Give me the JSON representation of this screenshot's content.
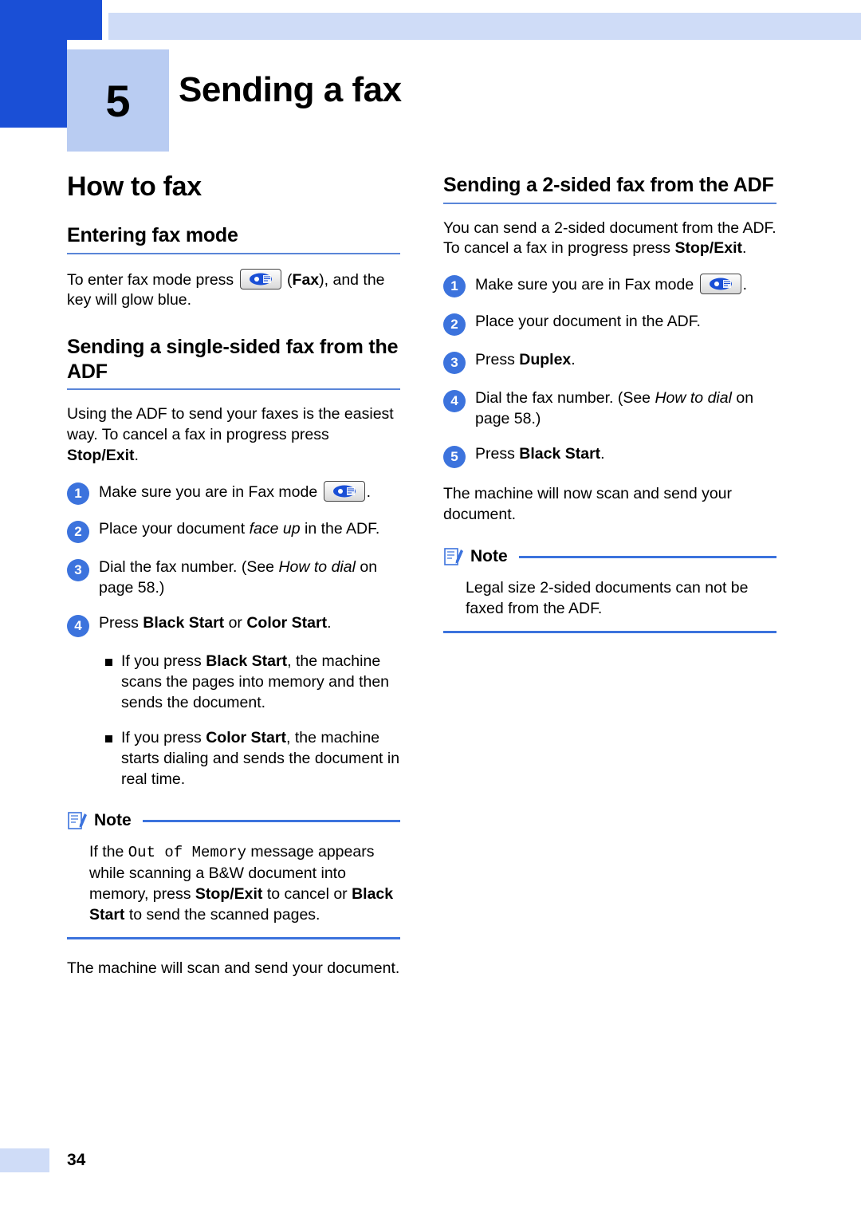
{
  "chapter": {
    "number": "5",
    "title": "Sending a fax"
  },
  "left": {
    "section_title": "How to fax",
    "entering": {
      "heading": "Entering fax mode",
      "para_a": "To enter fax mode press",
      "para_b": "(",
      "fax_bold": "Fax",
      "para_c": "), and the key will glow blue."
    },
    "single": {
      "heading": "Sending a single-sided fax from the ADF",
      "intro_a": "Using the ADF to send your faxes is the easiest way. To cancel a fax in progress press ",
      "intro_bold": "Stop/Exit",
      "intro_b": ".",
      "steps": [
        {
          "num": "1",
          "text": "Make sure you are in Fax mode",
          "suffix": "."
        },
        {
          "num": "2",
          "text_a": "Place your document ",
          "italic": "face up",
          "text_b": " in the ADF."
        },
        {
          "num": "3",
          "text_a": "Dial the fax number. (See ",
          "italic_a": "How to",
          "italic_b": "dial",
          "text_b": " on page 58.)"
        },
        {
          "num": "4",
          "text_a": "Press ",
          "bold_a": "Black Start",
          "text_b": " or ",
          "bold_b": "Color Start",
          "text_c": "."
        }
      ],
      "bullets": [
        {
          "text_a": "If you press ",
          "bold": "Black Start",
          "text_b": ", the machine scans the pages into memory and then sends the document."
        },
        {
          "text_a": "If you press ",
          "bold": "Color Start",
          "text_b": ", the machine starts dialing and sends the document in real time."
        }
      ]
    },
    "note": {
      "label": "Note",
      "body_a": "If the ",
      "mono": "Out of Memory",
      "body_b": " message appears while scanning a B&W document into memory, press ",
      "bold_a": "Stop/Exit",
      "body_c": " to cancel or ",
      "bold_b": "Black Start",
      "body_d": " to send the scanned pages."
    },
    "closing": "The machine will scan and send your document."
  },
  "right": {
    "twosided": {
      "heading": "Sending a 2-sided fax from the ADF",
      "intro_a": "You can send a 2-sided document from the ADF. To cancel a fax in progress press ",
      "intro_bold": "Stop/Exit",
      "intro_b": ".",
      "steps": [
        {
          "num": "1",
          "text": "Make sure you are in Fax mode",
          "suffix": "."
        },
        {
          "num": "2",
          "text": "Place your document in the ADF."
        },
        {
          "num": "3",
          "text_a": "Press ",
          "bold": "Duplex",
          "text_b": "."
        },
        {
          "num": "4",
          "text_a": "Dial the fax number. (See ",
          "italic_a": "How to",
          "italic_b": "dial",
          "text_b": " on page 58.)"
        },
        {
          "num": "5",
          "text_a": "Press ",
          "bold": "Black Start",
          "text_b": "."
        }
      ],
      "closing": "The machine will now scan and send your document."
    },
    "note": {
      "label": "Note",
      "body": "Legal size 2-sided documents can not be faxed from the ADF."
    }
  },
  "footer": {
    "page_number": "34"
  },
  "colors": {
    "accent_blue": "#1a4fd6",
    "rule_blue": "#3c73dd",
    "pale_blue": "#cfdcf7",
    "num_box_blue": "#b9ccf2"
  },
  "icons": {
    "fax_key": "fax-key-icon",
    "note": "note-pencil-icon"
  }
}
